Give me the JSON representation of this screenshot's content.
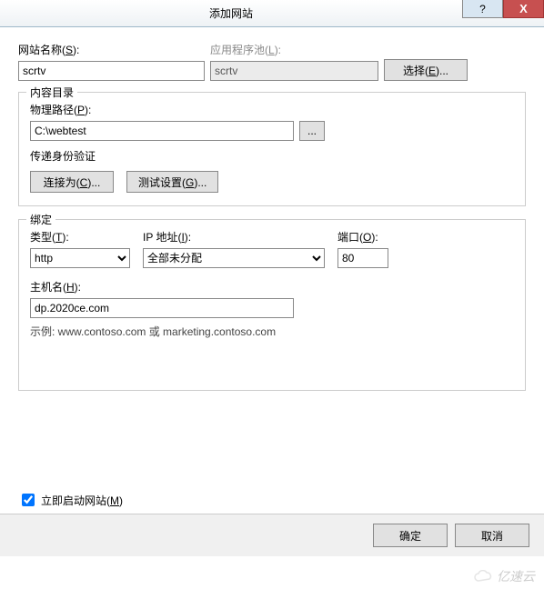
{
  "titlebar": {
    "title": "添加网站",
    "help": "?",
    "close": "X"
  },
  "siteName": {
    "label": "网站名称(S):",
    "label_key": "S",
    "value": "scrtv"
  },
  "appPool": {
    "label": "应用程序池(L):",
    "label_key": "L",
    "value": "scrtv",
    "selectBtn": "选择(E)...",
    "selectBtn_key": "E"
  },
  "contentDir": {
    "legend": "内容目录",
    "pathLabel": "物理路径(P):",
    "pathLabel_key": "P",
    "pathValue": "C:\\webtest",
    "browseBtn": "...",
    "authLabel": "传递身份验证",
    "connectAsBtn": "连接为(C)...",
    "connectAsBtn_key": "C",
    "testBtn": "测试设置(G)...",
    "testBtn_key": "G"
  },
  "binding": {
    "legend": "绑定",
    "typeLabel": "类型(T):",
    "typeLabel_key": "T",
    "typeValue": "http",
    "ipLabel": "IP 地址(I):",
    "ipLabel_key": "I",
    "ipValue": "全部未分配",
    "portLabel": "端口(O):",
    "portLabel_key": "O",
    "portValue": "80",
    "hostLabel": "主机名(H):",
    "hostLabel_key": "H",
    "hostValue": "dp.2020ce.com",
    "example": "示例: www.contoso.com 或 marketing.contoso.com"
  },
  "startNow": {
    "label": "立即启动网站(M)",
    "label_key": "M",
    "checked": true
  },
  "footer": {
    "ok": "确定",
    "cancel": "取消"
  },
  "watermark": "亿速云"
}
